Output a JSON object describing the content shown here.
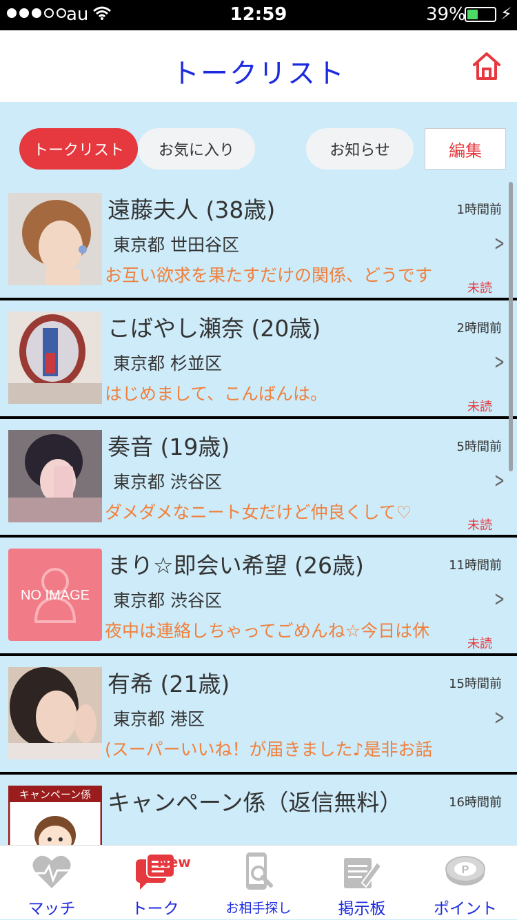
{
  "status_bar": {
    "carrier": "au",
    "time": "12:59",
    "battery_percent": "39%",
    "battery_level": 0.39
  },
  "header": {
    "title": "トークリスト"
  },
  "segments": {
    "talk_list": "トークリスト",
    "favorites": "お気に入り",
    "notices": "お知らせ",
    "edit": "編集"
  },
  "rows": [
    {
      "name": "遠藤夫人 (38歳)",
      "time": "1時間前",
      "location": "東京都 世田谷区",
      "message": "お互い欲求を果たすだけの関係、どうです",
      "unread": "未読"
    },
    {
      "name": "こばやし瀬奈 (20歳)",
      "time": "2時間前",
      "location": "東京都 杉並区",
      "message": "はじめまして、こんばんは。",
      "unread": "未読"
    },
    {
      "name": "奏音 (19歳)",
      "time": "5時間前",
      "location": "東京都 渋谷区",
      "message": "ダメダメなニート女だけど仲良くして♡",
      "unread": "未読"
    },
    {
      "name": "まり☆即会い希望 (26歳)",
      "time": "11時間前",
      "location": "東京都 渋谷区",
      "message": "夜中は連絡しちゃってごめんね☆今日は休",
      "unread": "未読",
      "avatar_text": "NO IMAGE"
    },
    {
      "name": "有希 (21歳)",
      "time": "15時間前",
      "location": "東京都 港区",
      "message": "(スーパーいいね！が届きました♪是非お話",
      "unread": ""
    },
    {
      "name": "キャンペーン係（返信無料）",
      "time": "16時間前",
      "location": "",
      "message": "",
      "unread": "",
      "avatar_text": "キャンペーン係"
    }
  ],
  "tabs": {
    "match": "マッチ",
    "talk": "トーク",
    "talk_badge": "New",
    "search": "お相手探し",
    "board": "掲示板",
    "points": "ポイント"
  },
  "colors": {
    "accent_red": "#e5393f",
    "title_blue": "#1c2be0",
    "message_orange": "#f0803c",
    "list_bg": "#cdebf9"
  }
}
